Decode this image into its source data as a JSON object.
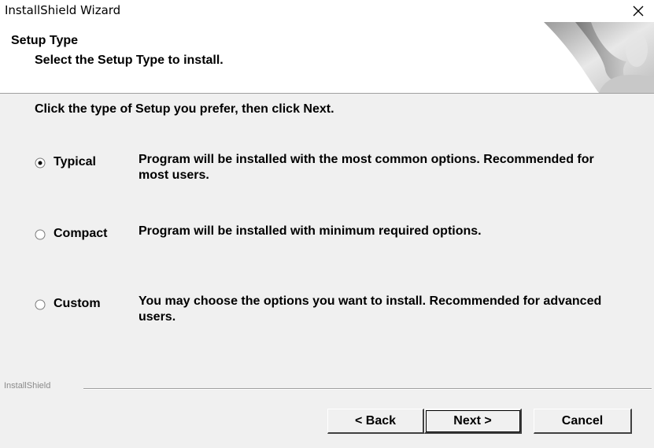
{
  "window": {
    "title": "InstallShield Wizard",
    "close_icon": "close-icon"
  },
  "header": {
    "title": "Setup Type",
    "subtitle": "Select the Setup Type to install."
  },
  "prompt": "Click the type of Setup you prefer, then click Next.",
  "options": [
    {
      "label": "Typical",
      "description": "Program will be installed with the most common options.  Recommended for most users.",
      "selected": true
    },
    {
      "label": "Compact",
      "description": "Program will be installed with minimum required options.",
      "selected": false
    },
    {
      "label": "Custom",
      "description": "You may choose the options you want to install. Recommended for advanced users.",
      "selected": false
    }
  ],
  "footer": {
    "brand": "InstallShield"
  },
  "buttons": {
    "back": "< Back",
    "next": "Next >",
    "cancel": "Cancel"
  }
}
